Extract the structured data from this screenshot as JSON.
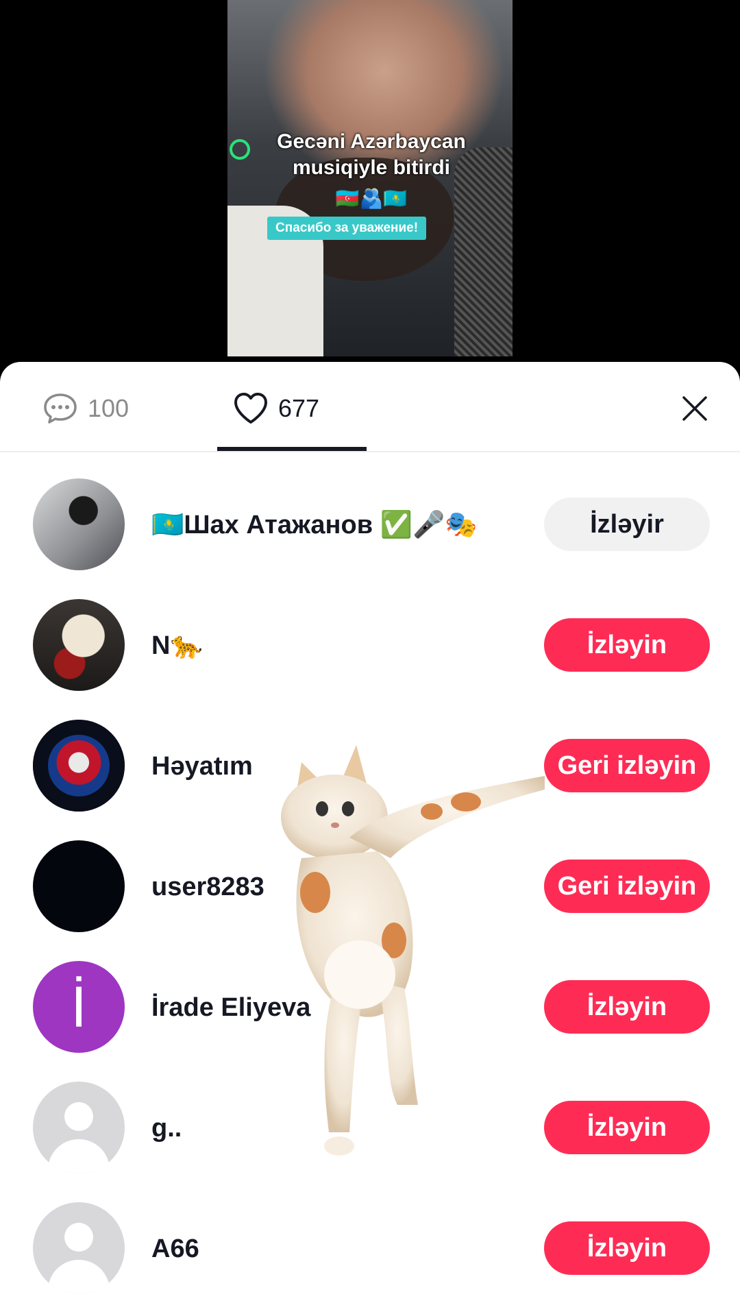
{
  "video": {
    "caption_line1": "Gecəni Azərbaycan",
    "caption_line2": "musiqiyle bitirdi",
    "flags": "🇦🇿🫂🇰🇿",
    "badge": "Спасибо за уважение!"
  },
  "tabs": {
    "comments_count": "100",
    "likes_count": "677"
  },
  "likers": [
    {
      "name": "🇰🇿Шах Атажанов ✅🎤🎭",
      "button": "İzləyir",
      "following": true
    },
    {
      "name": "N🐆",
      "button": "İzləyin",
      "following": false
    },
    {
      "name": "Həyatım",
      "button": "Geri izləyin",
      "following": false
    },
    {
      "name": "user8283",
      "button": "Geri izləyin",
      "following": false
    },
    {
      "name": "İrade Eliyeva",
      "button": "İzləyin",
      "following": false,
      "avatar_letter": "İ"
    },
    {
      "name": "g..",
      "button": "İzləyin",
      "following": false
    },
    {
      "name": "A66",
      "button": "İzləyin",
      "following": false
    }
  ],
  "colors": {
    "accent": "#fe2c55",
    "following_bg": "#f1f1f2",
    "avatar_purple": "#9e36c2"
  }
}
